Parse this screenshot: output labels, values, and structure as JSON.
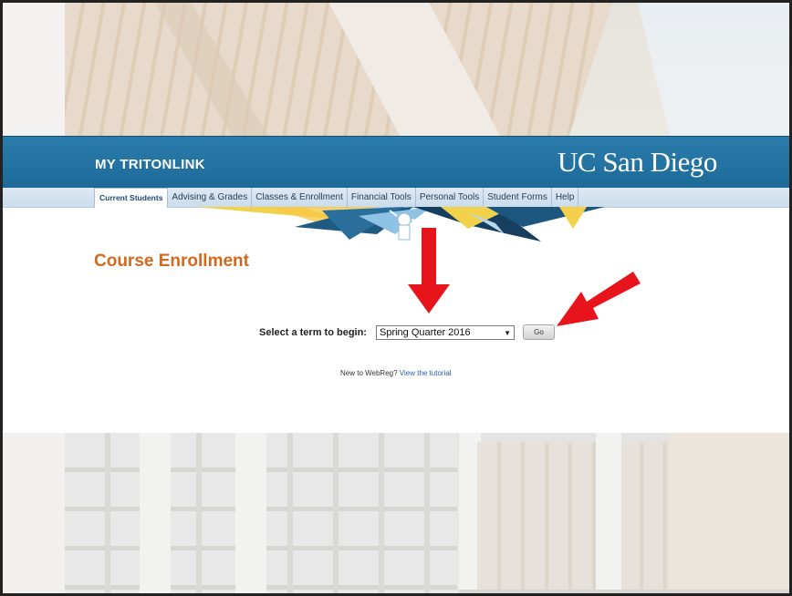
{
  "header": {
    "brand": "MY TRITONLINK",
    "university_logo": "UC San Diego"
  },
  "nav": {
    "items": [
      {
        "label": "Current Students",
        "active": true
      },
      {
        "label": "Advising & Grades",
        "active": false
      },
      {
        "label": "Classes & Enrollment",
        "active": false
      },
      {
        "label": "Financial Tools",
        "active": false
      },
      {
        "label": "Personal Tools",
        "active": false
      },
      {
        "label": "Student Forms",
        "active": false
      },
      {
        "label": "Help",
        "active": false
      }
    ]
  },
  "main": {
    "title": "Course Enrollment",
    "term_label": "Select a term to begin:",
    "term_selected": "Spring Quarter 2016",
    "go_label": "Go",
    "tutorial_prefix": "New to WebReg?",
    "tutorial_link": "View the tutorial"
  },
  "colors": {
    "header_blue": "#2173a3",
    "title_orange": "#d2691e",
    "arrow_red": "#e8141b"
  },
  "icons": {
    "select_caret": "chevron-down-icon",
    "annotation_arrows": "red-arrow-icon"
  }
}
